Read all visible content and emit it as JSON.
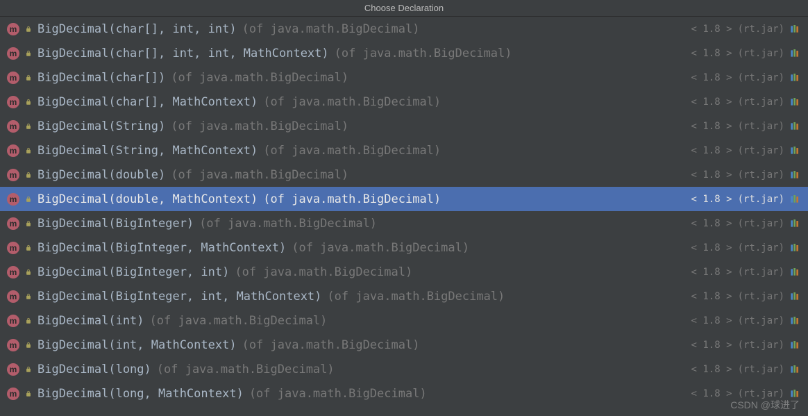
{
  "title": "Choose Declaration",
  "version_prefix": "< ",
  "version_suffix": " >",
  "jar_prefix": "(",
  "jar_suffix": ")",
  "watermark": "CSDN @球进了",
  "items": [
    {
      "signature": "BigDecimal(char[], int, int)",
      "location": "(of java.math.BigDecimal)",
      "version": "1.8",
      "jar": "rt.jar",
      "selected": false
    },
    {
      "signature": "BigDecimal(char[], int, int, MathContext)",
      "location": "(of java.math.BigDecimal)",
      "version": "1.8",
      "jar": "rt.jar",
      "selected": false
    },
    {
      "signature": "BigDecimal(char[])",
      "location": "(of java.math.BigDecimal)",
      "version": "1.8",
      "jar": "rt.jar",
      "selected": false
    },
    {
      "signature": "BigDecimal(char[], MathContext)",
      "location": "(of java.math.BigDecimal)",
      "version": "1.8",
      "jar": "rt.jar",
      "selected": false
    },
    {
      "signature": "BigDecimal(String)",
      "location": "(of java.math.BigDecimal)",
      "version": "1.8",
      "jar": "rt.jar",
      "selected": false
    },
    {
      "signature": "BigDecimal(String, MathContext)",
      "location": "(of java.math.BigDecimal)",
      "version": "1.8",
      "jar": "rt.jar",
      "selected": false
    },
    {
      "signature": "BigDecimal(double)",
      "location": "(of java.math.BigDecimal)",
      "version": "1.8",
      "jar": "rt.jar",
      "selected": false
    },
    {
      "signature": "BigDecimal(double, MathContext)",
      "location": "(of java.math.BigDecimal)",
      "version": "1.8",
      "jar": "rt.jar",
      "selected": true
    },
    {
      "signature": "BigDecimal(BigInteger)",
      "location": "(of java.math.BigDecimal)",
      "version": "1.8",
      "jar": "rt.jar",
      "selected": false
    },
    {
      "signature": "BigDecimal(BigInteger, MathContext)",
      "location": "(of java.math.BigDecimal)",
      "version": "1.8",
      "jar": "rt.jar",
      "selected": false
    },
    {
      "signature": "BigDecimal(BigInteger, int)",
      "location": "(of java.math.BigDecimal)",
      "version": "1.8",
      "jar": "rt.jar",
      "selected": false
    },
    {
      "signature": "BigDecimal(BigInteger, int, MathContext)",
      "location": "(of java.math.BigDecimal)",
      "version": "1.8",
      "jar": "rt.jar",
      "selected": false
    },
    {
      "signature": "BigDecimal(int)",
      "location": "(of java.math.BigDecimal)",
      "version": "1.8",
      "jar": "rt.jar",
      "selected": false
    },
    {
      "signature": "BigDecimal(int, MathContext)",
      "location": "(of java.math.BigDecimal)",
      "version": "1.8",
      "jar": "rt.jar",
      "selected": false
    },
    {
      "signature": "BigDecimal(long)",
      "location": "(of java.math.BigDecimal)",
      "version": "1.8",
      "jar": "rt.jar",
      "selected": false
    },
    {
      "signature": "BigDecimal(long, MathContext)",
      "location": "(of java.math.BigDecimal)",
      "version": "1.8",
      "jar": "rt.jar",
      "selected": false
    }
  ]
}
